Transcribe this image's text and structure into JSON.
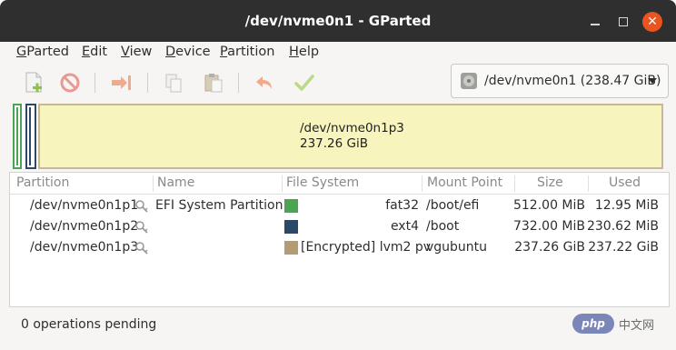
{
  "window": {
    "title": "/dev/nvme0n1 - GParted"
  },
  "menubar": [
    {
      "pre": "",
      "ul": "G",
      "post": "Parted"
    },
    {
      "pre": "",
      "ul": "E",
      "post": "dit"
    },
    {
      "pre": "",
      "ul": "V",
      "post": "iew"
    },
    {
      "pre": "",
      "ul": "D",
      "post": "evice"
    },
    {
      "pre": "",
      "ul": "P",
      "post": "artition"
    },
    {
      "pre": "",
      "ul": "H",
      "post": "elp"
    }
  ],
  "device_selector": {
    "value": "/dev/nvme0n1 (238.47 GiB)"
  },
  "partition_map": {
    "selected_name": "/dev/nvme0n1p3",
    "selected_size": "237.26 GiB"
  },
  "table": {
    "headers": [
      "Partition",
      "Name",
      "File System",
      "Mount Point",
      "Size",
      "Used"
    ],
    "rows": [
      {
        "partition": "/dev/nvme0n1p1",
        "name": "EFI System Partition",
        "fs": "fat32",
        "fs_color": "#4aa452",
        "mount": "/boot/efi",
        "size": "512.00 MiB",
        "used": "12.95 MiB"
      },
      {
        "partition": "/dev/nvme0n1p2",
        "name": "",
        "fs": "ext4",
        "fs_color": "#2c4868",
        "mount": "/boot",
        "size": "732.00 MiB",
        "used": "230.62 MiB"
      },
      {
        "partition": "/dev/nvme0n1p3",
        "name": "",
        "fs": "[Encrypted] lvm2 pv",
        "fs_color": "#b49b73",
        "mount": "vgubuntu",
        "size": "237.26 GiB",
        "used": "237.22 GiB"
      }
    ]
  },
  "statusbar": {
    "text": "0 operations pending"
  },
  "watermark": {
    "badge": "php",
    "text": "中文网"
  }
}
